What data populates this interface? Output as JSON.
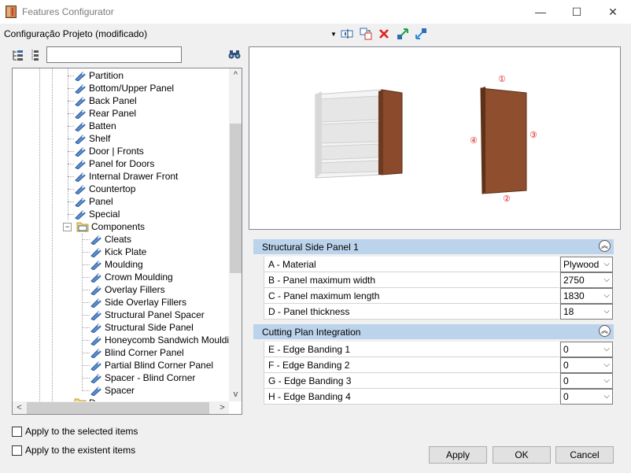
{
  "window": {
    "title": "Features Configurator",
    "minimize_glyph": "—",
    "maximize_glyph": "☐",
    "close_glyph": "✕"
  },
  "toolbar": {
    "profile_name": "Configuração Projeto (modificado)",
    "dropdown_glyph": "▼"
  },
  "tree": {
    "items": [
      {
        "label": "Partition"
      },
      {
        "label": "Bottom/Upper Panel"
      },
      {
        "label": "Back Panel"
      },
      {
        "label": "Rear Panel"
      },
      {
        "label": "Batten"
      },
      {
        "label": "Shelf"
      },
      {
        "label": "Door | Fronts"
      },
      {
        "label": "Panel for Doors"
      },
      {
        "label": "Internal Drawer Front"
      },
      {
        "label": "Countertop"
      },
      {
        "label": "Panel"
      },
      {
        "label": "Special"
      }
    ],
    "group": {
      "label": "Components",
      "expander": "−"
    },
    "sub_items": [
      {
        "label": "Cleats"
      },
      {
        "label": "Kick Plate"
      },
      {
        "label": "Moulding"
      },
      {
        "label": "Crown Moulding"
      },
      {
        "label": "Overlay Fillers"
      },
      {
        "label": "Side Overlay Fillers"
      },
      {
        "label": "Structural Panel Spacer"
      },
      {
        "label": "Structural Side Panel"
      },
      {
        "label": "Honeycomb Sandwich Moulding"
      },
      {
        "label": "Blind Corner Panel"
      },
      {
        "label": "Partial Blind Corner Panel"
      },
      {
        "label": "Spacer - Blind Corner"
      },
      {
        "label": "Spacer"
      }
    ],
    "partial_item": "D"
  },
  "preview": {
    "edge_labels": [
      "①",
      "②",
      "③",
      "④"
    ],
    "colors": {
      "wood": "#8b4a2b",
      "wood_dark": "#5a2e19",
      "carcass": "#e8e8e8"
    }
  },
  "sections": [
    {
      "title": "Structural Side Panel 1",
      "rows": [
        {
          "label": "A - Material",
          "value": "Plywood"
        },
        {
          "label": "B - Panel maximum width",
          "value": "2750"
        },
        {
          "label": "C - Panel maximum length",
          "value": "1830"
        },
        {
          "label": "D - Panel thickness",
          "value": "18"
        }
      ]
    },
    {
      "title": "Cutting Plan Integration",
      "rows": [
        {
          "label": "E - Edge Banding 1",
          "value": "0"
        },
        {
          "label": "F - Edge Banding 2",
          "value": "0"
        },
        {
          "label": "G - Edge Banding 3",
          "value": "0"
        },
        {
          "label": "H - Edge Banding 4",
          "value": "0"
        }
      ]
    }
  ],
  "collapse_glyph": "︽",
  "select_arrow": "⌵",
  "options": {
    "apply_selected": "Apply to the selected items",
    "apply_existent": "Apply to the existent items"
  },
  "buttons": {
    "apply": "Apply",
    "ok": "OK",
    "cancel": "Cancel"
  },
  "scroll": {
    "up": "^",
    "down": "v",
    "left": "<",
    "right": ">"
  }
}
